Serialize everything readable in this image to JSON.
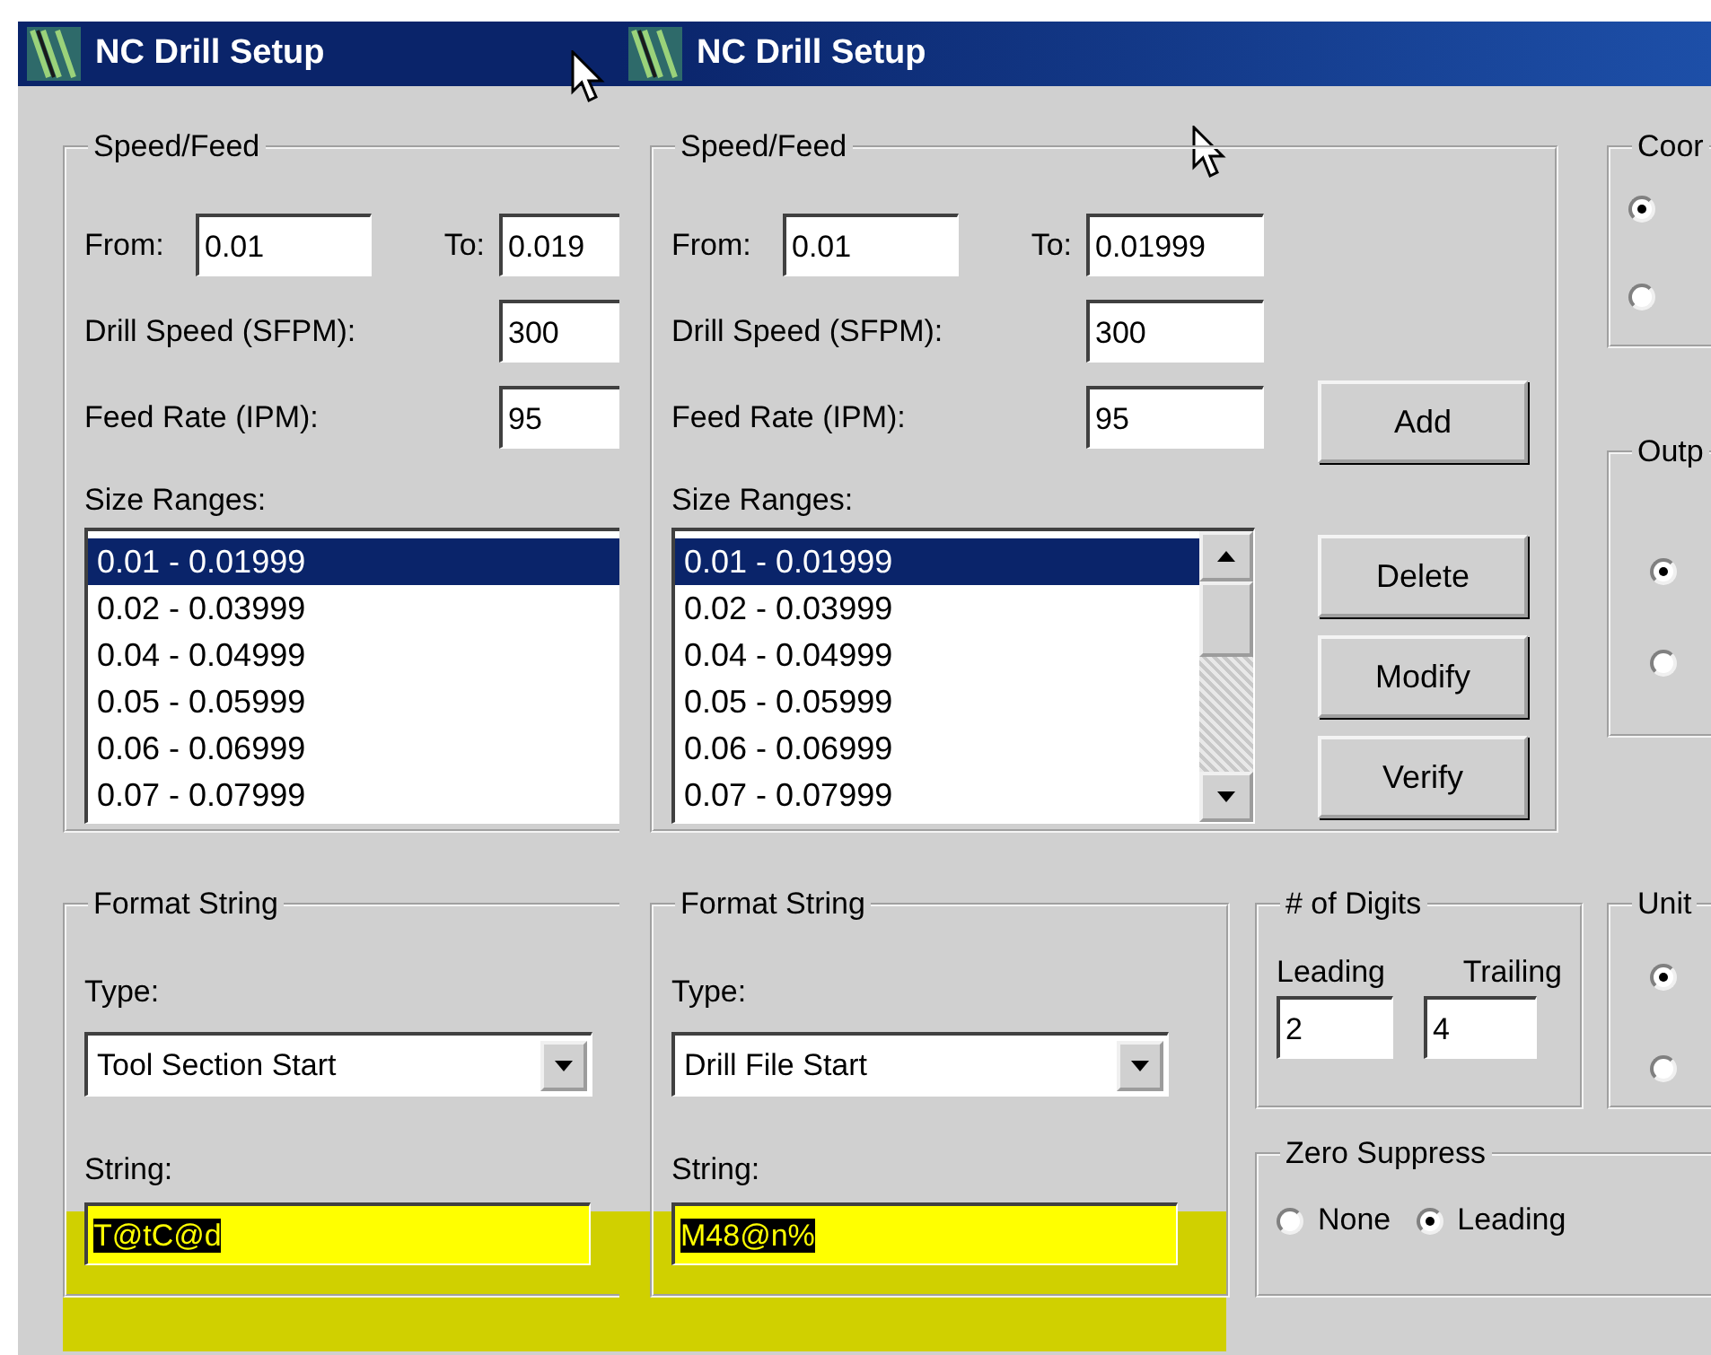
{
  "windows": [
    {
      "title": "NC Drill Setup",
      "speed_feed": {
        "label": "Speed/Feed",
        "from_label": "From:",
        "from": "0.01",
        "to_label": "To:",
        "to": "0.019",
        "drill_speed_label": "Drill Speed (SFPM):",
        "drill_speed": "300",
        "feed_rate_label": "Feed Rate (IPM):",
        "feed_rate": "95",
        "size_ranges_label": "Size Ranges:",
        "size_ranges": [
          {
            "text": "0.01 - 0.01999",
            "selected": true
          },
          {
            "text": "0.02 - 0.03999",
            "selected": false
          },
          {
            "text": "0.04 - 0.04999",
            "selected": false
          },
          {
            "text": "0.05 - 0.05999",
            "selected": false
          },
          {
            "text": "0.06 - 0.06999",
            "selected": false
          },
          {
            "text": "0.07 - 0.07999",
            "selected": false
          }
        ]
      },
      "format_string": {
        "label": "Format String",
        "type_label": "Type:",
        "type": "Tool Section Start",
        "string_label": "String:",
        "string": "T@tC@d",
        "text_selected": true,
        "highlighted": true
      }
    },
    {
      "title": "NC Drill Setup",
      "speed_feed": {
        "label": "Speed/Feed",
        "from_label": "From:",
        "from": "0.01",
        "to_label": "To:",
        "to": "0.01999",
        "drill_speed_label": "Drill Speed (SFPM):",
        "drill_speed": "300",
        "feed_rate_label": "Feed Rate (IPM):",
        "feed_rate": "95",
        "size_ranges_label": "Size Ranges:",
        "size_ranges": [
          {
            "text": "0.01 - 0.01999",
            "selected": true
          },
          {
            "text": "0.02 - 0.03999",
            "selected": false
          },
          {
            "text": "0.04 - 0.04999",
            "selected": false
          },
          {
            "text": "0.05 - 0.05999",
            "selected": false
          },
          {
            "text": "0.06 - 0.06999",
            "selected": false
          },
          {
            "text": "0.07 - 0.07999",
            "selected": false
          }
        ],
        "buttons": [
          "Add",
          "Delete",
          "Modify",
          "Verify"
        ]
      },
      "coordinates": {
        "label": "Coor",
        "options": [
          {
            "selected": true
          },
          {
            "selected": false
          }
        ]
      },
      "output": {
        "label": "Outp",
        "options": [
          {
            "selected": true
          },
          {
            "selected": false
          }
        ]
      },
      "format_string": {
        "label": "Format String",
        "type_label": "Type:",
        "type": "Drill File Start",
        "string_label": "String:",
        "string": "M48@n%",
        "text_selected": true,
        "highlighted": true
      },
      "digits": {
        "label": "# of Digits",
        "leading_label": "Leading",
        "trailing_label": "Trailing",
        "leading": "2",
        "trailing": "4"
      },
      "units": {
        "label": "Unit",
        "options": [
          {
            "selected": true
          },
          {
            "selected": false
          }
        ]
      },
      "zero_suppress": {
        "label": "Zero Suppress",
        "options": [
          {
            "label": "None",
            "selected": false
          },
          {
            "label": "Leading",
            "selected": true
          }
        ]
      }
    }
  ]
}
